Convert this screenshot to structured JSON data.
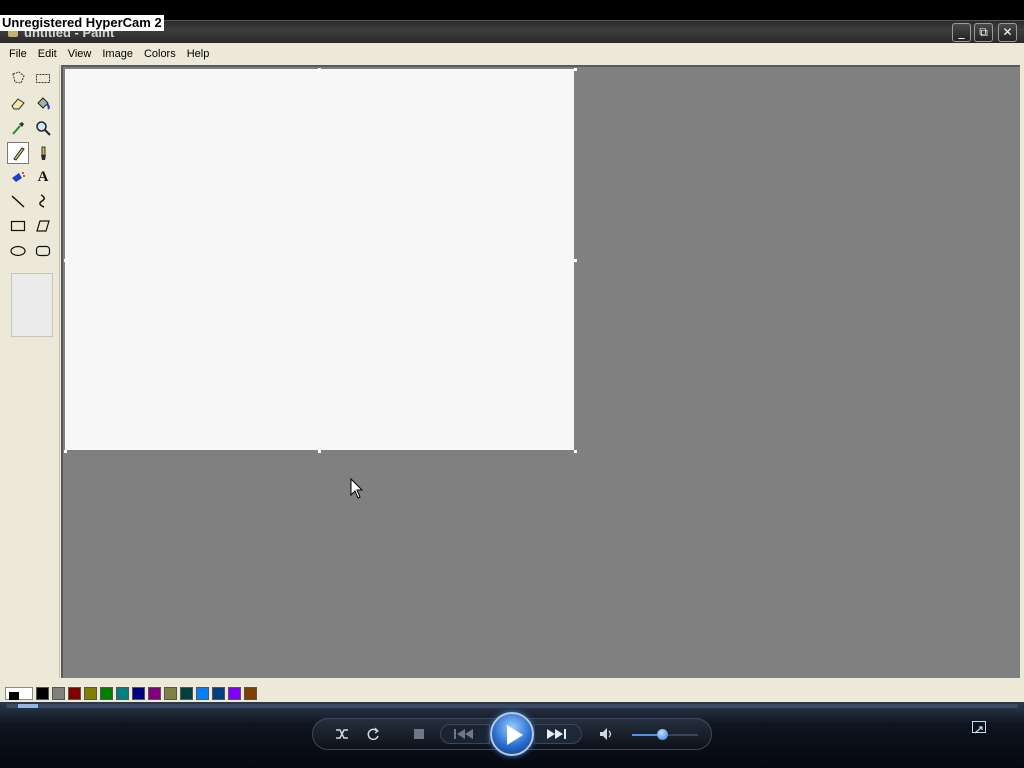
{
  "watermark": "Unregistered HyperCam 2",
  "window": {
    "title": "untitled - Paint",
    "buttons": {
      "minimize": "_",
      "maximize": "⧉",
      "close": "✕"
    }
  },
  "menu": [
    "File",
    "Edit",
    "View",
    "Image",
    "Colors",
    "Help"
  ],
  "tools": [
    {
      "name": "free-form-select",
      "icon": "free-select-icon"
    },
    {
      "name": "select",
      "icon": "rect-select-icon"
    },
    {
      "name": "eraser",
      "icon": "eraser-icon"
    },
    {
      "name": "fill-with-color",
      "icon": "fill-bucket-icon"
    },
    {
      "name": "pick-color",
      "icon": "eyedropper-icon"
    },
    {
      "name": "magnifier",
      "icon": "magnifier-icon"
    },
    {
      "name": "pencil",
      "icon": "pencil-icon",
      "selected": true
    },
    {
      "name": "brush",
      "icon": "brush-icon"
    },
    {
      "name": "airbrush",
      "icon": "airbrush-icon"
    },
    {
      "name": "text",
      "icon": "text-icon",
      "glyph": "A"
    },
    {
      "name": "line",
      "icon": "line-icon"
    },
    {
      "name": "curve",
      "icon": "curve-icon"
    },
    {
      "name": "rectangle",
      "icon": "rectangle-icon"
    },
    {
      "name": "polygon",
      "icon": "polygon-icon"
    },
    {
      "name": "ellipse",
      "icon": "ellipse-icon"
    },
    {
      "name": "rounded-rectangle",
      "icon": "rounded-rectangle-icon"
    }
  ],
  "palette": {
    "foreground": "#000000",
    "background": "#ffffff",
    "colors": [
      "#000000",
      "#808080",
      "#800000",
      "#808000",
      "#008000",
      "#008080",
      "#000080",
      "#800080",
      "#808040",
      "#004040",
      "#0080ff",
      "#004080",
      "#8000ff",
      "#804000"
    ]
  },
  "player": {
    "volume_level": 0.45,
    "buttons": [
      "shuffle-icon",
      "repeat-icon",
      "stop-icon",
      "previous-icon",
      "play-icon",
      "next-icon",
      "volume-icon",
      "fullscreen-icon"
    ]
  }
}
